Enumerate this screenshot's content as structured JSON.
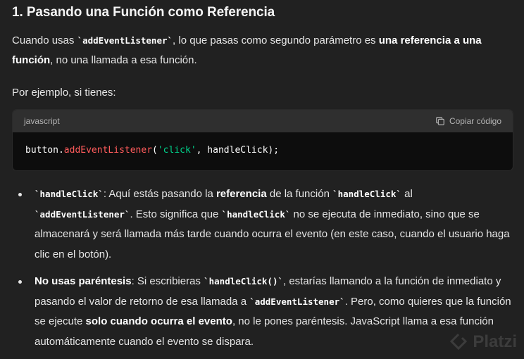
{
  "heading": "1. Pasando una Función como Referencia",
  "lead": {
    "t1": "Cuando usas ",
    "code1": "`addEventListener`",
    "t2": ", lo que pasas como segundo parámetro es ",
    "b1": "una referencia a una función",
    "t3": ", no una llamada a esa función."
  },
  "example_intro": "Por ejemplo, si tienes:",
  "codeblock": {
    "language": "javascript",
    "copy_label": "Copiar código",
    "obj": "button.",
    "method": "addEventListener",
    "open": "(",
    "arg_str": "'click'",
    "rest": ", handleClick);"
  },
  "bullets": [
    {
      "code1": "`handleClick`",
      "t1": ": Aquí estás pasando la ",
      "b1": "referencia",
      "t2": " de la función ",
      "code2": "`handleClick`",
      "t3": " al ",
      "code3": "`addEventListener`",
      "t4": ". Esto significa que ",
      "code4": "`handleClick`",
      "t5": " no se ejecuta de inmediato, sino que se almacenará y será llamada más tarde cuando ocurra el evento (en este caso, cuando el usuario haga clic en el botón)."
    },
    {
      "b1": "No usas paréntesis",
      "t1": ": Si escribieras ",
      "code1": "`handleClick()`",
      "t2": ", estarías llamando a la función de inmediato y pasando el valor de retorno de esa llamada a ",
      "code2": "`addEventListener`",
      "t3": ". Pero, como quieres que la función se ejecute ",
      "b2": "solo cuando ocurra el evento",
      "t4": ", no le pones paréntesis. JavaScript llama a esa función automáticamente cuando el evento se dispara."
    }
  ],
  "watermark": "Platzi",
  "icons": {
    "copy": "copy-icon",
    "logo": "platzi-logo-icon"
  }
}
